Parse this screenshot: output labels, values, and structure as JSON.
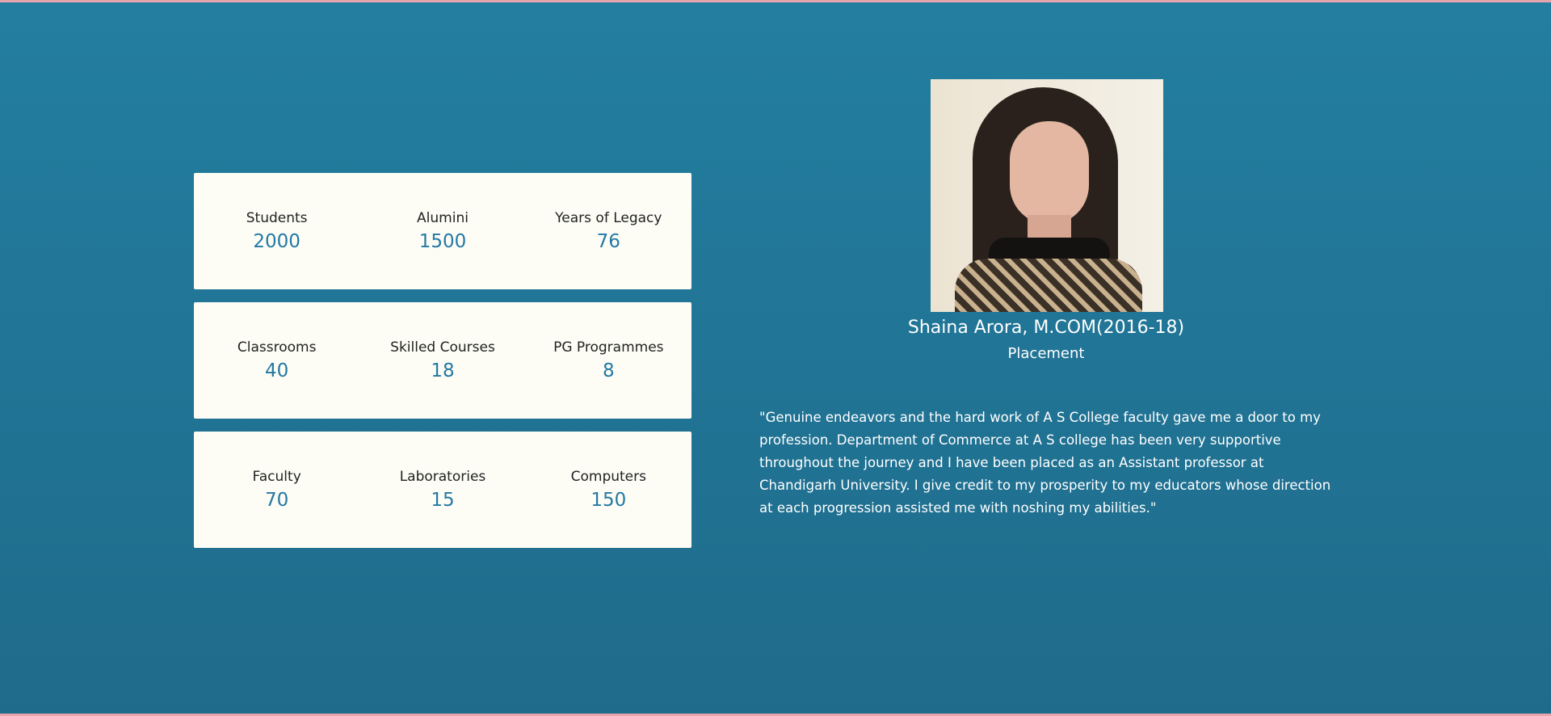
{
  "stats": {
    "rows": [
      {
        "items": [
          {
            "label": "Students",
            "value": "2000"
          },
          {
            "label": "Alumini",
            "value": "1500"
          },
          {
            "label": "Years of Legacy",
            "value": "76"
          }
        ]
      },
      {
        "items": [
          {
            "label": "Classrooms",
            "value": "40"
          },
          {
            "label": "Skilled Courses",
            "value": "18"
          },
          {
            "label": "PG Programmes",
            "value": "8"
          }
        ]
      },
      {
        "items": [
          {
            "label": "Faculty",
            "value": "70"
          },
          {
            "label": "Laboratories",
            "value": "15"
          },
          {
            "label": "Computers",
            "value": "150"
          }
        ]
      }
    ]
  },
  "testimonial": {
    "name": "Shaina Arora, M.COM(2016-18)",
    "role": "Placement",
    "quote": "\"Genuine endeavors and the hard work of A S College faculty gave me a door to my profession. Department of Commerce at A S college has been very supportive throughout the journey and I have been placed as an Assistant professor at Chandigarh University. I give credit to my prosperity to my educators whose direction at each progression assisted me with noshing my abilities.\""
  },
  "colors": {
    "background_top": "#237ea0",
    "background_bottom": "#1f6b8b",
    "card_background": "#fdfdf6",
    "stat_value": "#2379a3",
    "border_accent": "#e6a5ad"
  }
}
